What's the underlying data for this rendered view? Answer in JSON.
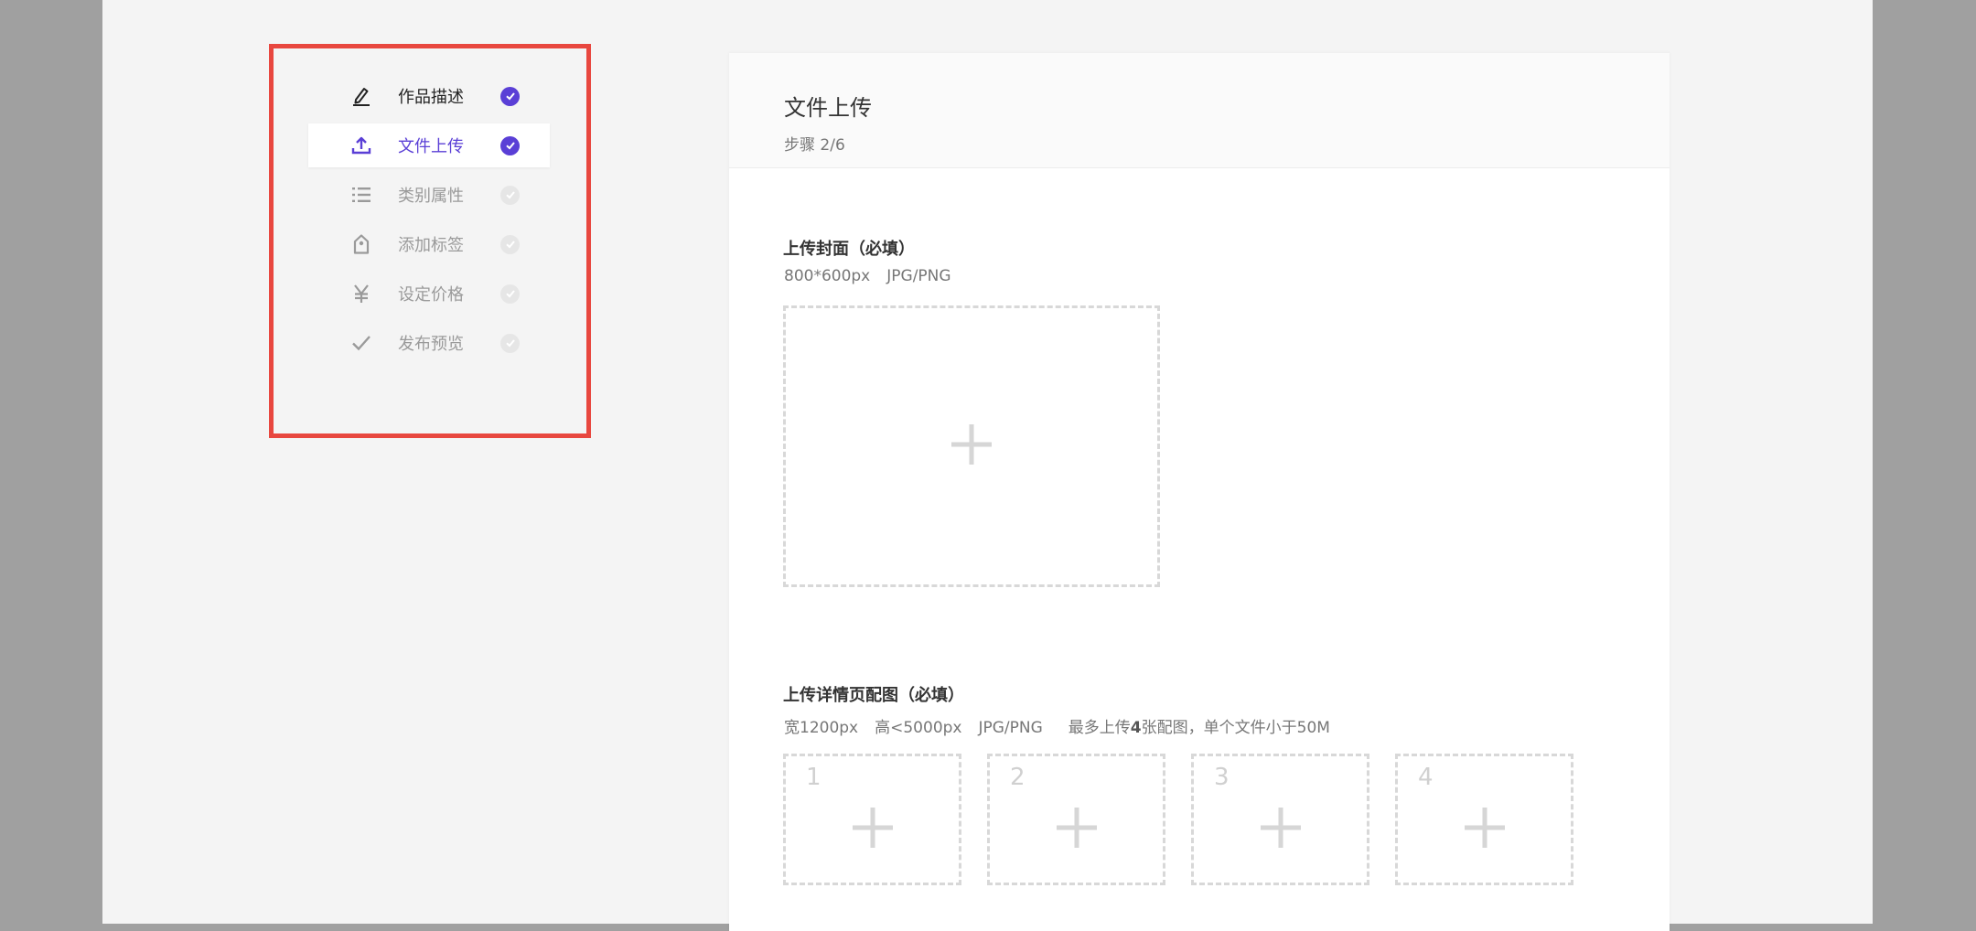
{
  "steps": [
    {
      "label": "作品描述",
      "status": "done",
      "icon": "pencil-icon"
    },
    {
      "label": "文件上传",
      "status": "active",
      "icon": "upload-icon"
    },
    {
      "label": "类别属性",
      "status": "pending",
      "icon": "list-icon"
    },
    {
      "label": "添加标签",
      "status": "pending",
      "icon": "tag-icon"
    },
    {
      "label": "设定价格",
      "status": "pending",
      "icon": "yen-icon"
    },
    {
      "label": "发布预览",
      "status": "pending",
      "icon": "checkmark-icon"
    }
  ],
  "card": {
    "title": "文件上传",
    "step_text": "步骤 2/6"
  },
  "cover": {
    "title": "上传封面（必填）",
    "spec_size": "800*600px",
    "spec_format": "JPG/PNG"
  },
  "details": {
    "title": "上传详情页配图（必填）",
    "spec_width": "宽1200px",
    "spec_height": "高<5000px",
    "spec_format": "JPG/PNG",
    "spec_limit_prefix": "最多上传",
    "spec_limit_count": "4",
    "spec_limit_suffix": "张配图，单个文件小于50M",
    "slots": [
      "1",
      "2",
      "3",
      "4"
    ]
  },
  "colors": {
    "accent": "#5a3fd6",
    "highlight_border": "#e8473f"
  }
}
